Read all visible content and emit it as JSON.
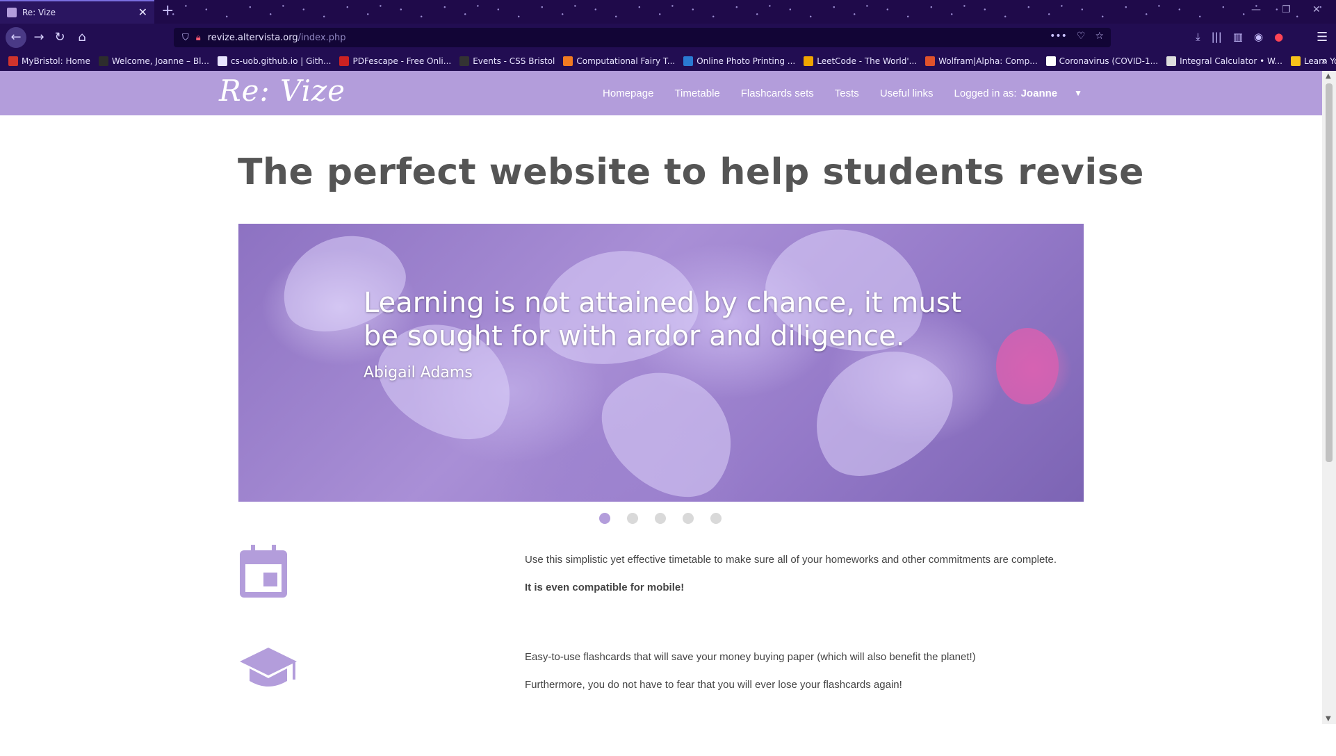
{
  "browser": {
    "tab_title": "Re: Vize",
    "tab_close": "✕",
    "new_tab": "+",
    "url_host": "revize.altervista.org",
    "url_path": "/index.php",
    "bookmarks": [
      {
        "label": "MyBristol: Home",
        "color": "#d0342c"
      },
      {
        "label": "Welcome, Joanne – Bl...",
        "color": "#2d2d2d"
      },
      {
        "label": "cs-uob.github.io | Gith...",
        "color": "#e8e4ff"
      },
      {
        "label": "PDFescape - Free Onli...",
        "color": "#cc2222"
      },
      {
        "label": "Events - CSS Bristol",
        "color": "#333333"
      },
      {
        "label": "Computational Fairy T...",
        "color": "#f27b21"
      },
      {
        "label": "Online Photo Printing ...",
        "color": "#2a7ad2"
      },
      {
        "label": "LeetCode - The World'...",
        "color": "#f0a500"
      },
      {
        "label": "Wolfram|Alpha: Comp...",
        "color": "#e0522b"
      },
      {
        "label": "Coronavirus (COVID-1...",
        "color": "#ffffff"
      },
      {
        "label": "Integral Calculator • W...",
        "color": "#dddddd"
      },
      {
        "label": "Learn You a Haskell fo...",
        "color": "#f7c21a"
      }
    ]
  },
  "site": {
    "logo": "Re: Vize",
    "nav": {
      "homepage": "Homepage",
      "timetable": "Timetable",
      "flashcards": "Flashcards sets",
      "tests": "Tests",
      "useful_links": "Useful links",
      "logged_in_label": "Logged in as:",
      "user_name": "Joanne"
    },
    "headline": "The perfect website to help students revise",
    "carousel": {
      "quote": "Learning is not attained by chance, it must be sought for with ardor and diligence.",
      "author": "Abigail Adams",
      "slides": 5,
      "active_slide": 1
    },
    "features": [
      {
        "icon": "calendar-icon",
        "text1": "Use this simplistic yet effective timetable to make sure all of your homeworks and other commitments are complete.",
        "text2": "It is even compatible for mobile!"
      },
      {
        "icon": "graduation-cap-icon",
        "text1": "Easy-to-use flashcards that will save your money buying paper (which will also benefit the planet!)",
        "text2": "Furthermore, you do not have to fear that you will ever lose your flashcards again!"
      }
    ],
    "accent_color": "#b39ddb"
  }
}
